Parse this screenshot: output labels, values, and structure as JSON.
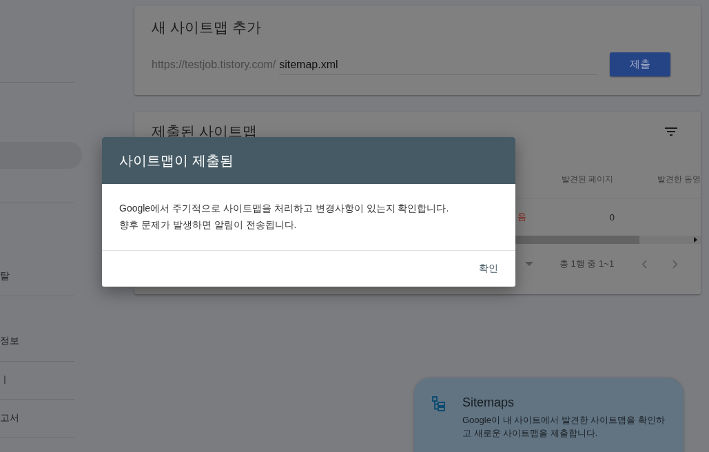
{
  "sidebar": {
    "items": [
      {
        "label": "탈",
        "selected": false
      },
      {
        "label": "정보",
        "selected": false
      },
      {
        "label": "ㅣ",
        "selected": false
      },
      {
        "label": "고서",
        "selected": false
      }
    ]
  },
  "add_sitemap": {
    "title": "새 사이트맵 추가",
    "url_prefix": "https://testjob.tistory.com/",
    "input_value": "sitemap.xml",
    "submit_button": "제출"
  },
  "submitted_sitemaps": {
    "title": "제출된 사이트맵",
    "columns": [
      "발견된 페이지",
      "발견한 동영"
    ],
    "rows": [
      {
        "status": "음",
        "pages": "0"
      }
    ],
    "pagination": {
      "range": "총 1행 중 1~1"
    }
  },
  "dialog": {
    "title": "사이트맵이 제출됨",
    "message_lines": [
      "Google에서 주기적으로 사이트맵을 처리하고 변경사항이 있는지 확인합니다.",
      "향후 문제가 발생하면 알림이 전송됩니다."
    ],
    "ok_button": "확인"
  },
  "help_card": {
    "title": "Sitemaps",
    "description": "Google이 내 사이트에서 발견한 사이트맵을 확인하고 새로운 사이트맵을 제출합니다."
  }
}
